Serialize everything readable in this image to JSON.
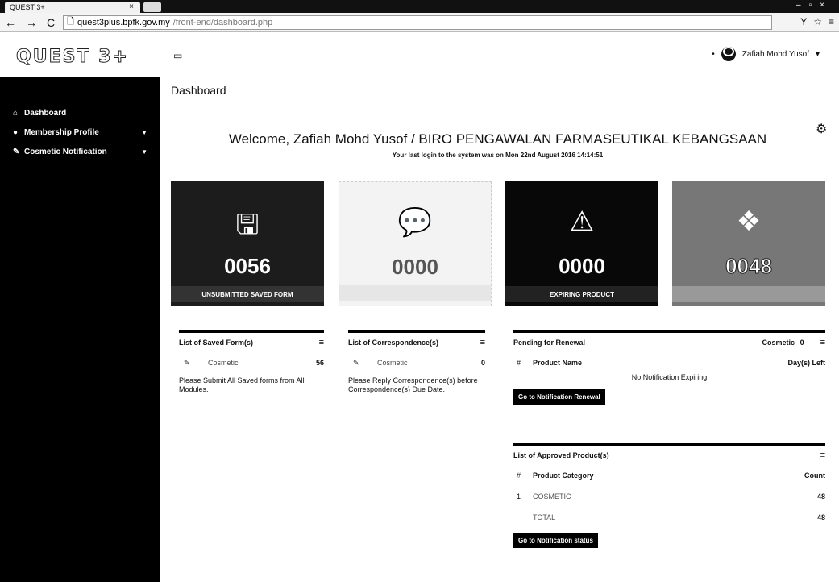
{
  "browser": {
    "tab_title": "QUEST 3+",
    "url_host": "quest3plus.bpfk.gov.my",
    "url_path": "/front-end/dashboard.php"
  },
  "app": {
    "logo": "QUEST 3+",
    "user_name": "Zafiah Mohd Yusof"
  },
  "sidebar": {
    "items": [
      {
        "label": "Dashboard"
      },
      {
        "label": "Membership Profile"
      },
      {
        "label": "Cosmetic Notification"
      }
    ]
  },
  "main": {
    "breadcrumb": "Dashboard",
    "welcome": "Welcome, Zafiah Mohd Yusof / BIRO PENGAWALAN FARMASEUTIKAL KEBANGSAAN",
    "last_login": "Your last login to the system was on Mon 22nd August 2016 14:14:51"
  },
  "tiles": [
    {
      "value": "0056",
      "label": "UNSUBMITTED SAVED FORM",
      "icon": "floppy-icon"
    },
    {
      "value": "0000",
      "label": "",
      "icon": "speech-bubble-icon"
    },
    {
      "value": "0000",
      "label": "EXPIRING PRODUCT",
      "icon": "warning-icon"
    },
    {
      "value": "0048",
      "label": "",
      "icon": "box-icon"
    }
  ],
  "saved_forms": {
    "title": "List of Saved Form(s)",
    "row_label": "Cosmetic",
    "row_count": "56",
    "note": "Please Submit All Saved forms from All Modules."
  },
  "correspondence": {
    "title": "List of Correspondence(s)",
    "row_label": "Cosmetic",
    "row_count": "0",
    "note": "Please Reply Correspondence(s) before Correspondence(s) Due Date."
  },
  "renewal": {
    "title": "Pending for Renewal",
    "filter_label": "Cosmetic",
    "filter_count": "0",
    "col_num": "#",
    "col_product": "Product Name",
    "col_days": "Day(s) Left",
    "empty": "No Notification Expiring",
    "button": "Go to Notification Renewal"
  },
  "approved": {
    "title": "List of Approved Product(s)",
    "col_num": "#",
    "col_category": "Product Category",
    "col_count": "Count",
    "rows": [
      {
        "num": "1",
        "category": "COSMETIC",
        "count": "48"
      },
      {
        "num": "",
        "category": "TOTAL",
        "count": "48"
      }
    ],
    "button": "Go to Notification status"
  }
}
